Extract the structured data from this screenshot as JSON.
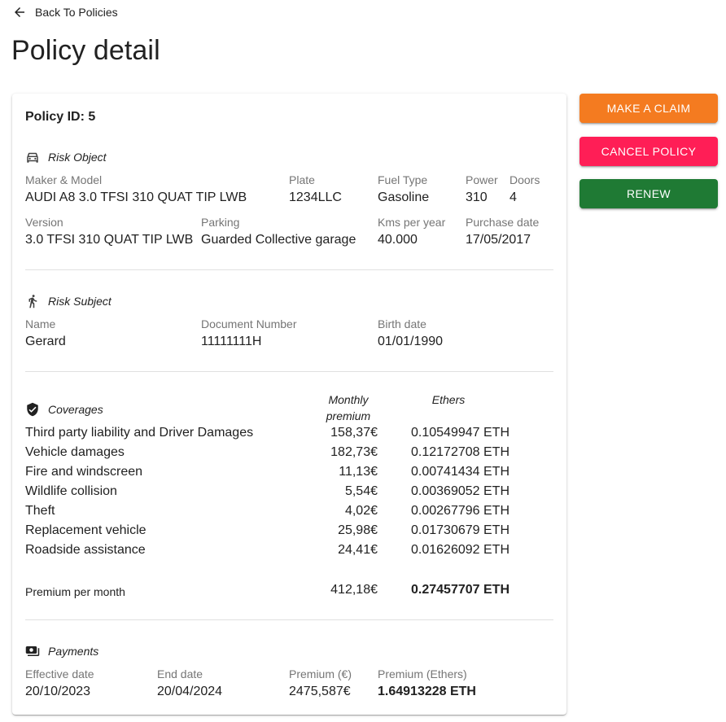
{
  "back_link": {
    "label": "Back To Policies",
    "icon": "arrow-left-icon"
  },
  "page_title": "Policy detail",
  "policy_id": "Policy ID: 5",
  "risk_object": {
    "title": "Risk Object",
    "icon": "car-icon",
    "maker_model": {
      "label": "Maker & Model",
      "value": "AUDI A8 3.0 TFSI 310 QUAT TIP LWB"
    },
    "plate": {
      "label": "Plate",
      "value": "1234LLC"
    },
    "fuel_type": {
      "label": "Fuel Type",
      "value": "Gasoline"
    },
    "power": {
      "label": "Power",
      "value": "310"
    },
    "doors": {
      "label": "Doors",
      "value": "4"
    },
    "version": {
      "label": "Version",
      "value": "3.0 TFSI 310 QUAT TIP LWB"
    },
    "parking": {
      "label": "Parking",
      "value": "Guarded Collective garage"
    },
    "kms_per_year": {
      "label": "Kms per year",
      "value": "40.000"
    },
    "purchase_date": {
      "label": "Purchase date",
      "value": "17/05/2017"
    }
  },
  "risk_subject": {
    "title": "Risk Subject",
    "icon": "person-icon",
    "name": {
      "label": "Name",
      "value": "Gerard"
    },
    "document_number": {
      "label": "Document Number",
      "value": "11111111H"
    },
    "birth_date": {
      "label": "Birth date",
      "value": "01/01/1990"
    }
  },
  "coverages": {
    "title": "Coverages",
    "icon": "shield-check-icon",
    "col_monthly_line1": "Monthly",
    "col_monthly_line2": "premium",
    "col_ethers": "Ethers",
    "rows": [
      {
        "name": "Third party liability and Driver Damages",
        "monthly": "158,37€",
        "ethers": "0.10549947 ETH"
      },
      {
        "name": "Vehicle damages",
        "monthly": "182,73€",
        "ethers": "0.12172708 ETH"
      },
      {
        "name": "Fire and windscreen",
        "monthly": "11,13€",
        "ethers": "0.00741434 ETH"
      },
      {
        "name": "Wildlife collision",
        "monthly": "5,54€",
        "ethers": "0.00369052 ETH"
      },
      {
        "name": "Theft",
        "monthly": "4,02€",
        "ethers": "0.00267796 ETH"
      },
      {
        "name": "Replacement vehicle",
        "monthly": "25,98€",
        "ethers": "0.01730679 ETH"
      },
      {
        "name": "Roadside assistance",
        "monthly": "24,41€",
        "ethers": "0.01626092 ETH"
      }
    ],
    "total": {
      "label": "Premium per month",
      "monthly": "412,18€",
      "ethers": "0.27457707 ETH"
    }
  },
  "payments": {
    "title": "Payments",
    "icon": "payments-icon",
    "effective_date": {
      "label": "Effective date",
      "value": "20/10/2023"
    },
    "end_date": {
      "label": "End date",
      "value": "20/04/2024"
    },
    "premium_eur": {
      "label": "Premium (€)",
      "value": "2475,587€"
    },
    "premium_eth": {
      "label": "Premium (Ethers)",
      "value": "1.64913228 ETH"
    }
  },
  "actions": {
    "make_claim": {
      "label": "MAKE A CLAIM",
      "color": "#f47b20"
    },
    "cancel_policy": {
      "label": "CANCEL POLICY",
      "color": "#ff1e56"
    },
    "renew": {
      "label": "RENEW",
      "color": "#1f7a34"
    }
  }
}
